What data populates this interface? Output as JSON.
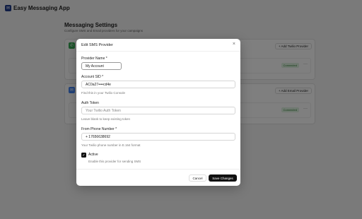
{
  "app": {
    "title": "Easy Messaging App",
    "logo_icon": "app-logo-icon"
  },
  "page": {
    "title": "Messaging Settings",
    "subtitle": "Configure SMS and Email providers for your campaigns"
  },
  "sms_card": {
    "add_label": "+ Add Twilio Provider",
    "status": "Connected",
    "more": "···"
  },
  "email_card": {
    "add_label": "+ Add Email Provider",
    "status": "Connected",
    "more": "···"
  },
  "modal": {
    "title": "Edit SMS Provider",
    "close": "×",
    "fields": {
      "provider_name": {
        "label": "Provider Name *",
        "value": "My Account"
      },
      "account_sid": {
        "label": "Account SID *",
        "value": "AC0a27••••cd4e",
        "help": "Find this in your Twilio Console"
      },
      "auth_token": {
        "label": "Auth Token",
        "placeholder": "Your Twilio Auth Token",
        "help": "Leave blank to keep existing token"
      },
      "phone": {
        "label": "From Phone Number *",
        "value": "+ 17656638692",
        "help": "Your Twilio phone number in E.164 format"
      }
    },
    "active": {
      "label": "Active",
      "checked": true,
      "help": "Enable this provider for sending SMS"
    },
    "buttons": {
      "cancel": "Cancel",
      "save": "Save Changes"
    }
  },
  "colors": {
    "overlay": "rgba(0,0,0,0.5)",
    "primary_button": "#111111",
    "connected_badge": "#dff3e1",
    "sms_icon": "#34a853",
    "email_icon": "#4285f4"
  }
}
